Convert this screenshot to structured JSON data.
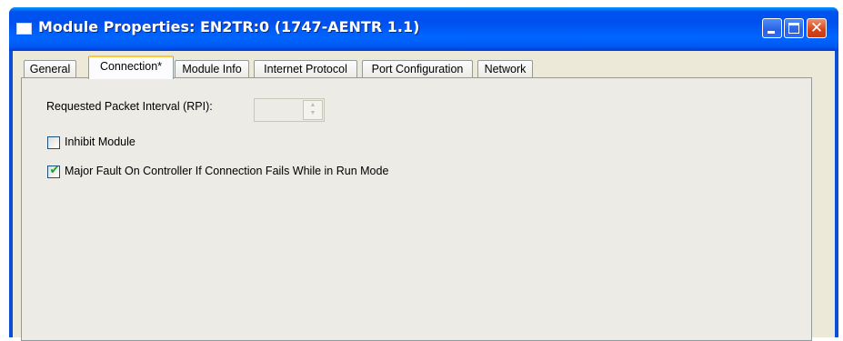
{
  "window": {
    "title": "Module Properties: EN2TR:0 (1747-AENTR 1.1)",
    "controls": {
      "minimize_icon": "minimize-icon",
      "maximize_icon": "maximize-icon",
      "close_glyph": "✕"
    }
  },
  "tabs": [
    {
      "label": "General"
    },
    {
      "label": "Connection*",
      "active": true
    },
    {
      "label": "Module Info"
    },
    {
      "label": "Internet Protocol"
    },
    {
      "label": "Port Configuration"
    },
    {
      "label": "Network"
    }
  ],
  "connection": {
    "rpi_label": "Requested Packet Interval (RPI):",
    "rpi_value": "",
    "spin_up": "▲",
    "spin_down": "▼",
    "inhibit_label": "Inhibit Module",
    "inhibit_checked": false,
    "major_fault_label": "Major Fault On Controller If Connection Fails While in Run Mode",
    "major_fault_checked": true,
    "check_glyph": "✔"
  },
  "colors": {
    "titlebar": "#0058ee",
    "window_border": "#0a4fd4",
    "tab_highlight": "#ffc83c",
    "panel": "#ecebe5",
    "checkmark": "#21a121"
  }
}
